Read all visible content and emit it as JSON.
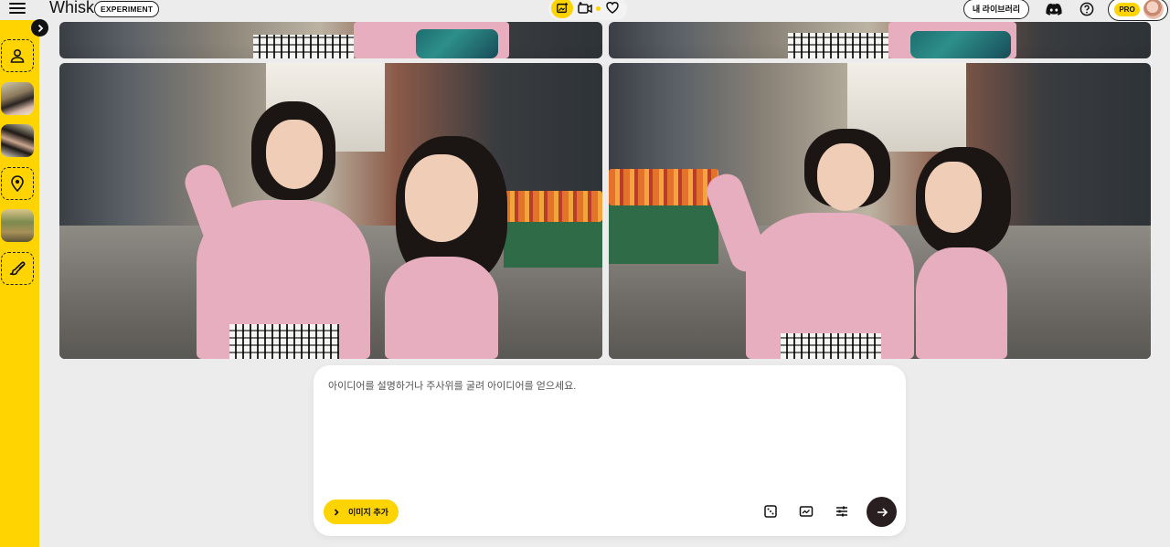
{
  "app": {
    "title": "Whisk",
    "badge": "EXPERIMENT"
  },
  "header": {
    "mode_switch": {
      "image_icon": "image-sparkle-icon",
      "video_icon": "video-icon",
      "favorites_icon": "heart-icon"
    },
    "library_label": "내 라이브러리",
    "discord_icon": "discord-icon",
    "help_icon": "help-icon",
    "plan_badge": "PRO"
  },
  "sidebar": {
    "items": [
      {
        "kind": "slot",
        "icon": "person-icon"
      },
      {
        "kind": "thumbnail",
        "name": "subject-image-1"
      },
      {
        "kind": "thumbnail",
        "name": "subject-image-2"
      },
      {
        "kind": "slot",
        "icon": "location-pin-icon"
      },
      {
        "kind": "thumbnail",
        "name": "scene-image"
      },
      {
        "kind": "slot",
        "icon": "brush-icon"
      }
    ]
  },
  "prompt": {
    "placeholder": "아이디어를 설명하거나 주사위를 굴려 아이디어를 얻으세요.",
    "add_image_label": "이미지 추가",
    "tools": [
      "dice-icon",
      "aspect-ratio-icon",
      "settings-sliders-icon"
    ],
    "submit_icon": "arrow-right-icon"
  },
  "colors": {
    "accent": "#ffd400",
    "background": "#ececec",
    "dark": "#2a1f20"
  }
}
